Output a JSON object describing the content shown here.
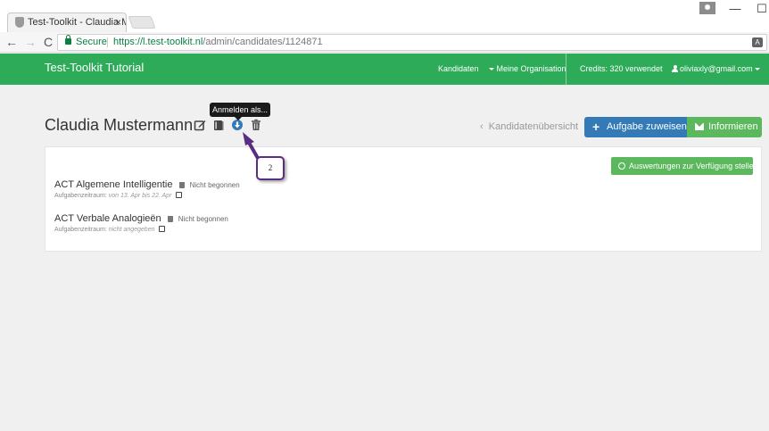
{
  "browser": {
    "tab_title": "Test-Toolkit - Claudia Mu",
    "tab_close": "×",
    "secure_label": "Secure",
    "url_host": "https://l.test-toolkit.nl",
    "url_path": "/admin/candidates/1124871",
    "nav_back": "←",
    "nav_forward": "→",
    "nav_reload": "C",
    "win_min": "—",
    "win_max": "☐"
  },
  "header": {
    "brand": "Test-Toolkit Tutorial",
    "nav": {
      "kandidaten": "Kandidaten",
      "organisation": "Meine Organisation",
      "credits": "Credits: 320 verwendet",
      "user": "oliviaxly@gmail.com"
    }
  },
  "page": {
    "title": "Claudia Mustermann",
    "tooltip": "Anmelden als...",
    "back_link": "Kandidatenübersicht",
    "assign_button": "Aufgabe zuweisen",
    "inform_button": "Informieren",
    "release_button": "Auswertungen zur Verfügung stellen",
    "annotation_step": "2"
  },
  "tasks": [
    {
      "name": "ACT Algemene Intelligentie",
      "status": "Nicht begonnen",
      "period_label": "Aufgabenzeitraum:",
      "period_value": "von 13. Apr bis 22. Apr"
    },
    {
      "name": "ACT Verbale Analogieën",
      "status": "Nicht begonnen",
      "period_label": "Aufgabenzeitraum:",
      "period_value": "nicht angegeben"
    }
  ],
  "colors": {
    "header_green": "#2dab59",
    "primary_blue": "#337ab7",
    "success_green": "#5cb85c",
    "annotation_purple": "#5a2d83"
  }
}
